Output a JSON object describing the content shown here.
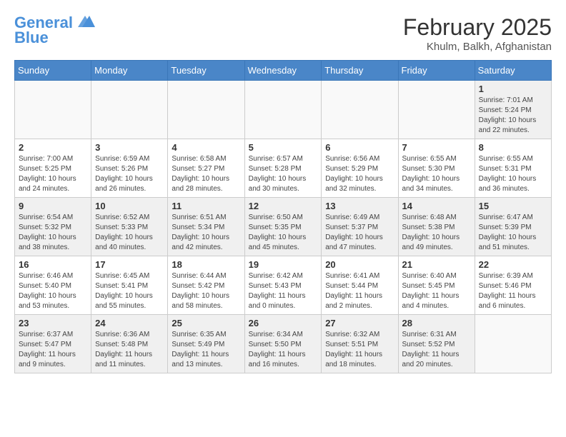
{
  "header": {
    "logo_line1": "General",
    "logo_line2": "Blue",
    "month_year": "February 2025",
    "location": "Khulm, Balkh, Afghanistan"
  },
  "weekdays": [
    "Sunday",
    "Monday",
    "Tuesday",
    "Wednesday",
    "Thursday",
    "Friday",
    "Saturday"
  ],
  "weeks": [
    [
      {
        "day": "",
        "info": ""
      },
      {
        "day": "",
        "info": ""
      },
      {
        "day": "",
        "info": ""
      },
      {
        "day": "",
        "info": ""
      },
      {
        "day": "",
        "info": ""
      },
      {
        "day": "",
        "info": ""
      },
      {
        "day": "1",
        "info": "Sunrise: 7:01 AM\nSunset: 5:24 PM\nDaylight: 10 hours\nand 22 minutes."
      }
    ],
    [
      {
        "day": "2",
        "info": "Sunrise: 7:00 AM\nSunset: 5:25 PM\nDaylight: 10 hours\nand 24 minutes."
      },
      {
        "day": "3",
        "info": "Sunrise: 6:59 AM\nSunset: 5:26 PM\nDaylight: 10 hours\nand 26 minutes."
      },
      {
        "day": "4",
        "info": "Sunrise: 6:58 AM\nSunset: 5:27 PM\nDaylight: 10 hours\nand 28 minutes."
      },
      {
        "day": "5",
        "info": "Sunrise: 6:57 AM\nSunset: 5:28 PM\nDaylight: 10 hours\nand 30 minutes."
      },
      {
        "day": "6",
        "info": "Sunrise: 6:56 AM\nSunset: 5:29 PM\nDaylight: 10 hours\nand 32 minutes."
      },
      {
        "day": "7",
        "info": "Sunrise: 6:55 AM\nSunset: 5:30 PM\nDaylight: 10 hours\nand 34 minutes."
      },
      {
        "day": "8",
        "info": "Sunrise: 6:55 AM\nSunset: 5:31 PM\nDaylight: 10 hours\nand 36 minutes."
      }
    ],
    [
      {
        "day": "9",
        "info": "Sunrise: 6:54 AM\nSunset: 5:32 PM\nDaylight: 10 hours\nand 38 minutes."
      },
      {
        "day": "10",
        "info": "Sunrise: 6:52 AM\nSunset: 5:33 PM\nDaylight: 10 hours\nand 40 minutes."
      },
      {
        "day": "11",
        "info": "Sunrise: 6:51 AM\nSunset: 5:34 PM\nDaylight: 10 hours\nand 42 minutes."
      },
      {
        "day": "12",
        "info": "Sunrise: 6:50 AM\nSunset: 5:35 PM\nDaylight: 10 hours\nand 45 minutes."
      },
      {
        "day": "13",
        "info": "Sunrise: 6:49 AM\nSunset: 5:37 PM\nDaylight: 10 hours\nand 47 minutes."
      },
      {
        "day": "14",
        "info": "Sunrise: 6:48 AM\nSunset: 5:38 PM\nDaylight: 10 hours\nand 49 minutes."
      },
      {
        "day": "15",
        "info": "Sunrise: 6:47 AM\nSunset: 5:39 PM\nDaylight: 10 hours\nand 51 minutes."
      }
    ],
    [
      {
        "day": "16",
        "info": "Sunrise: 6:46 AM\nSunset: 5:40 PM\nDaylight: 10 hours\nand 53 minutes."
      },
      {
        "day": "17",
        "info": "Sunrise: 6:45 AM\nSunset: 5:41 PM\nDaylight: 10 hours\nand 55 minutes."
      },
      {
        "day": "18",
        "info": "Sunrise: 6:44 AM\nSunset: 5:42 PM\nDaylight: 10 hours\nand 58 minutes."
      },
      {
        "day": "19",
        "info": "Sunrise: 6:42 AM\nSunset: 5:43 PM\nDaylight: 11 hours\nand 0 minutes."
      },
      {
        "day": "20",
        "info": "Sunrise: 6:41 AM\nSunset: 5:44 PM\nDaylight: 11 hours\nand 2 minutes."
      },
      {
        "day": "21",
        "info": "Sunrise: 6:40 AM\nSunset: 5:45 PM\nDaylight: 11 hours\nand 4 minutes."
      },
      {
        "day": "22",
        "info": "Sunrise: 6:39 AM\nSunset: 5:46 PM\nDaylight: 11 hours\nand 6 minutes."
      }
    ],
    [
      {
        "day": "23",
        "info": "Sunrise: 6:37 AM\nSunset: 5:47 PM\nDaylight: 11 hours\nand 9 minutes."
      },
      {
        "day": "24",
        "info": "Sunrise: 6:36 AM\nSunset: 5:48 PM\nDaylight: 11 hours\nand 11 minutes."
      },
      {
        "day": "25",
        "info": "Sunrise: 6:35 AM\nSunset: 5:49 PM\nDaylight: 11 hours\nand 13 minutes."
      },
      {
        "day": "26",
        "info": "Sunrise: 6:34 AM\nSunset: 5:50 PM\nDaylight: 11 hours\nand 16 minutes."
      },
      {
        "day": "27",
        "info": "Sunrise: 6:32 AM\nSunset: 5:51 PM\nDaylight: 11 hours\nand 18 minutes."
      },
      {
        "day": "28",
        "info": "Sunrise: 6:31 AM\nSunset: 5:52 PM\nDaylight: 11 hours\nand 20 minutes."
      },
      {
        "day": "",
        "info": ""
      }
    ]
  ]
}
